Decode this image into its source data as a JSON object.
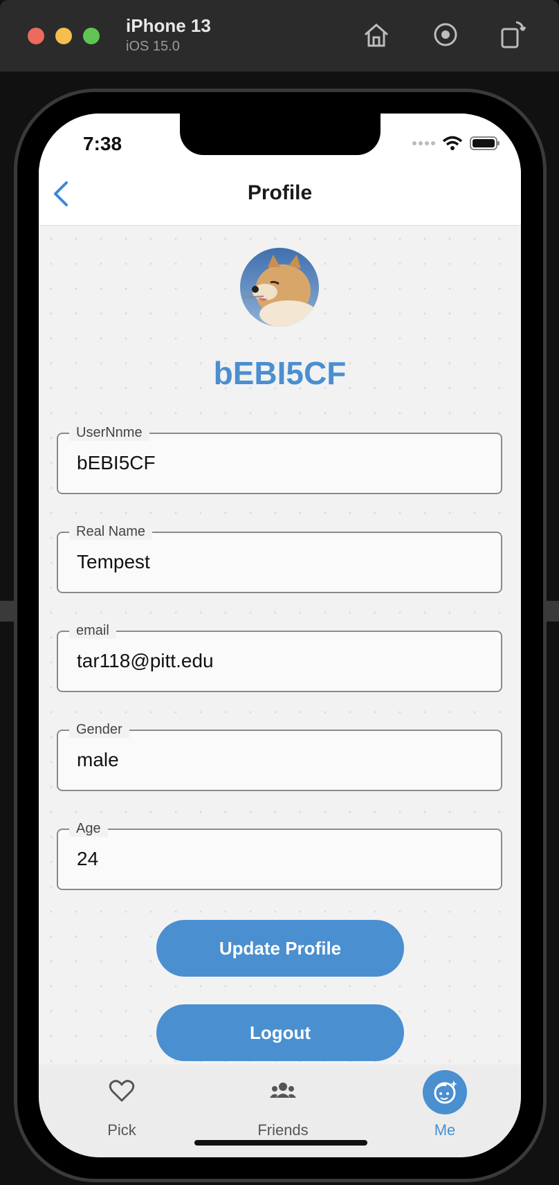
{
  "simulator": {
    "device": "iPhone 13",
    "os": "iOS 15.0"
  },
  "status_bar": {
    "time": "7:38"
  },
  "nav": {
    "title": "Profile"
  },
  "profile": {
    "display_name": "bEBI5CF"
  },
  "fields": [
    {
      "label": "UserNnme",
      "value": "bEBI5CF"
    },
    {
      "label": "Real Name",
      "value": "Tempest"
    },
    {
      "label": "email",
      "value": "tar118@pitt.edu"
    },
    {
      "label": "Gender",
      "value": "male"
    },
    {
      "label": "Age",
      "value": "24"
    }
  ],
  "buttons": {
    "update": "Update Profile",
    "logout": "Logout"
  },
  "tabs": [
    {
      "label": "Pick",
      "icon": "heart-icon"
    },
    {
      "label": "Friends",
      "icon": "people-icon"
    },
    {
      "label": "Me",
      "icon": "face-icon"
    }
  ],
  "colors": {
    "accent": "#4a8fd0"
  }
}
